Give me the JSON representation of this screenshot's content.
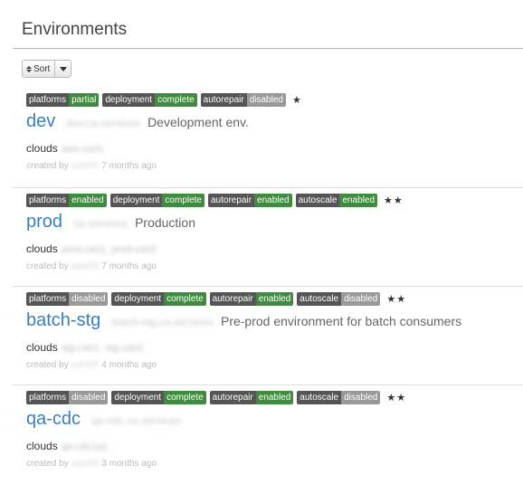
{
  "page": {
    "title": "Environments"
  },
  "toolbar": {
    "sort_label": "Sort"
  },
  "environments": [
    {
      "tags": [
        {
          "key": "platforms",
          "value": "partial",
          "color": "#3f8b3f"
        },
        {
          "key": "deployment",
          "value": "complete",
          "color": "#3f8b3f"
        },
        {
          "key": "autorepair",
          "value": "disabled",
          "color": "#999999"
        }
      ],
      "stars": "★",
      "name": "dev",
      "domain": "dev.ca.services",
      "description": "Development env.",
      "clouds_label": "clouds",
      "clouds_value": "aws-ca01",
      "created_prefix": "created by",
      "created_by": "user01",
      "created_ago": "7 months ago"
    },
    {
      "tags": [
        {
          "key": "platforms",
          "value": "enabled",
          "color": "#3f8b3f"
        },
        {
          "key": "deployment",
          "value": "complete",
          "color": "#3f8b3f"
        },
        {
          "key": "autorepair",
          "value": "enabled",
          "color": "#3f8b3f"
        },
        {
          "key": "autoscale",
          "value": "enabled",
          "color": "#3f8b3f"
        }
      ],
      "stars": "★★",
      "name": "prod",
      "domain": "ca.services",
      "description": "Production",
      "clouds_label": "clouds",
      "clouds_value": "prod-ca01, prod-ca02",
      "created_prefix": "created by",
      "created_by": "user02",
      "created_ago": "7 months ago"
    },
    {
      "tags": [
        {
          "key": "platforms",
          "value": "disabled",
          "color": "#999999"
        },
        {
          "key": "deployment",
          "value": "complete",
          "color": "#3f8b3f"
        },
        {
          "key": "autorepair",
          "value": "enabled",
          "color": "#3f8b3f"
        },
        {
          "key": "autoscale",
          "value": "disabled",
          "color": "#999999"
        }
      ],
      "stars": "★★",
      "name": "batch-stg",
      "domain": "batch-stg.ca.services",
      "description": "Pre-prod environment for batch consumers",
      "clouds_label": "clouds",
      "clouds_value": "stg-ca01, stg-ca02",
      "created_prefix": "created by",
      "created_by": "user03",
      "created_ago": "4 months ago"
    },
    {
      "tags": [
        {
          "key": "platforms",
          "value": "disabled",
          "color": "#999999"
        },
        {
          "key": "deployment",
          "value": "complete",
          "color": "#3f8b3f"
        },
        {
          "key": "autorepair",
          "value": "enabled",
          "color": "#3f8b3f"
        },
        {
          "key": "autoscale",
          "value": "disabled",
          "color": "#999999"
        }
      ],
      "stars": "★★",
      "name": "qa-cdc",
      "domain": "qa-cdc.ca.services",
      "description": "",
      "clouds_label": "clouds",
      "clouds_value": "qa-cdc1a1",
      "created_prefix": "created by",
      "created_by": "user04",
      "created_ago": "3 months ago"
    }
  ]
}
